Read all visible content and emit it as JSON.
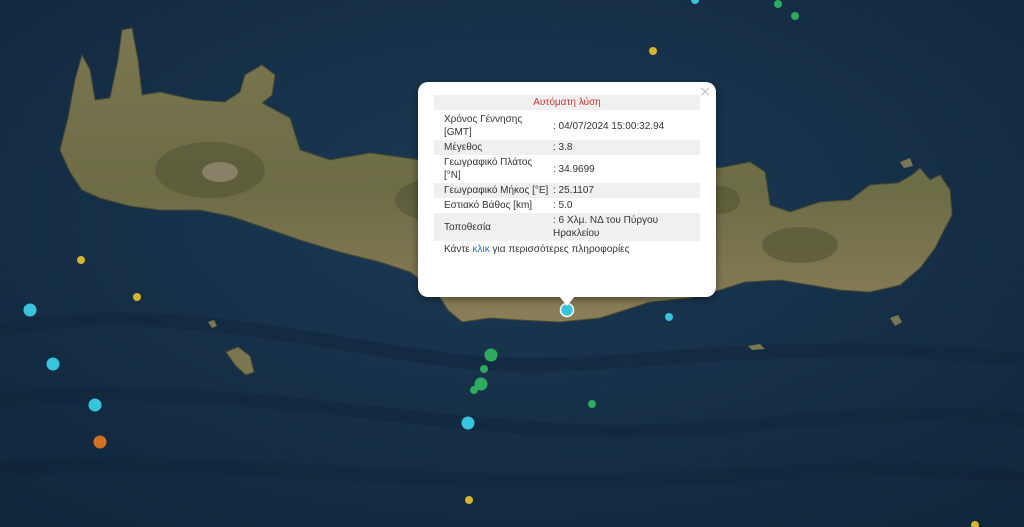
{
  "map": {
    "colors": {
      "sea": "#163048",
      "land": "#7d7a55",
      "land_dark": "#5e5f3d"
    },
    "events": [
      {
        "id": "ev1",
        "color": "#36c5dc",
        "selected": true
      },
      {
        "id": "ev2",
        "color": "#36c5dc"
      },
      {
        "id": "ev3",
        "color": "#36c5dc"
      },
      {
        "id": "ev4",
        "color": "#36c5dc"
      },
      {
        "id": "ev5",
        "color": "#36c5dc"
      },
      {
        "id": "ev6",
        "color": "#36c5dc"
      },
      {
        "id": "ev7",
        "color": "#36c5dc"
      },
      {
        "id": "ev8",
        "color": "#d2701f"
      },
      {
        "id": "ev9",
        "color": "#2eab5f"
      },
      {
        "id": "ev10",
        "color": "#2eab5f"
      },
      {
        "id": "ev11",
        "color": "#2eab5f"
      },
      {
        "id": "ev12",
        "color": "#2eab5f"
      },
      {
        "id": "ev13",
        "color": "#2eab5f"
      },
      {
        "id": "ev14",
        "color": "#2eab5f"
      },
      {
        "id": "ev15",
        "color": "#2eab5f"
      },
      {
        "id": "ev16",
        "color": "#d6b52c"
      },
      {
        "id": "ev17",
        "color": "#d6b52c"
      },
      {
        "id": "ev18",
        "color": "#d6b52c"
      },
      {
        "id": "ev19",
        "color": "#d6b52c"
      },
      {
        "id": "ev20",
        "color": "#d6b52c"
      }
    ]
  },
  "popup": {
    "close_icon": "×",
    "title": "Αυτόματη λύση",
    "rows": [
      {
        "label": "Χρόνος Γέννησης [GMT]",
        "value": ": 04/07/2024 15:00:32.94"
      },
      {
        "label": "Μέγεθος",
        "value": ": 3.8"
      },
      {
        "label": "Γεωγραφικό Πλάτος [°N]",
        "value": ": 34.9699"
      },
      {
        "label": "Γεωγραφικό Μήκος [°E]",
        "value": ": 25.1107"
      },
      {
        "label": "Εστιακό Βάθος [km]",
        "value": ": 5.0"
      },
      {
        "label": "Τοποθεσία",
        "value": ": 6 Χλμ. ΝΔ του Πύργου Ηρακλείου"
      }
    ],
    "footer_pre": "Κάντε",
    "footer_link": "κλικ",
    "footer_post": "για περισσότερες πληροφορίες"
  }
}
